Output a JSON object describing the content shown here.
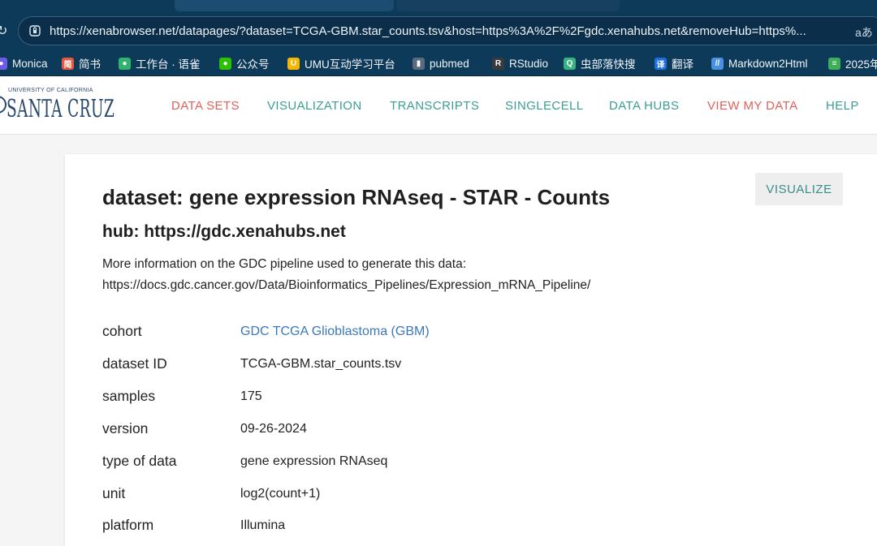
{
  "browser": {
    "url": "https://xenabrowser.net/datapages/?dataset=TCGA-GBM.star_counts.tsv&host=https%3A%2F%2Fgdc.xenahubs.net&removeHub=https%...",
    "reader_label": "aあ",
    "bookmarks": [
      {
        "label": "Monica",
        "icon": "monica-icon",
        "color": "#6c5ce7"
      },
      {
        "label": "简书",
        "icon": "jianshu-icon",
        "color": "#e9573f"
      },
      {
        "label": "工作台 · 语雀",
        "icon": "yuque-icon",
        "color": "#2fb36d"
      },
      {
        "label": "公众号",
        "icon": "wechat-icon",
        "color": "#2dc100"
      },
      {
        "label": "UMU互动学习平台",
        "icon": "umu-icon",
        "color": "#f5b700"
      },
      {
        "label": "pubmed",
        "icon": "pubmed-icon",
        "color": "#5a6b7d"
      },
      {
        "label": "RStudio",
        "icon": "rstudio-icon",
        "color": "#3a3a3a"
      },
      {
        "label": "虫部落快搜",
        "icon": "chongbuluo-icon",
        "color": "#36b37e"
      },
      {
        "label": "翻译",
        "icon": "translate-icon",
        "color": "#1e6fe0"
      },
      {
        "label": "Markdown2Html",
        "icon": "markdown-icon",
        "color": "#4a90e2"
      },
      {
        "label": "2025年",
        "icon": "doc-icon",
        "color": "#3fae5a"
      }
    ]
  },
  "logo": {
    "small": "UNIVERSITY OF CALIFORNIA",
    "big": "SANTA CRUZ"
  },
  "nav": [
    {
      "label": "DATA SETS",
      "color": "#e0605a"
    },
    {
      "label": "VISUALIZATION",
      "color": "#3a9e95"
    },
    {
      "label": "TRANSCRIPTS",
      "color": "#3a9e95"
    },
    {
      "label": "SINGLECELL",
      "color": "#3a9e95"
    },
    {
      "label": "DATA HUBS",
      "color": "#3a9e95"
    },
    {
      "label": "VIEW MY DATA",
      "color": "#e0605a"
    },
    {
      "label": "HELP",
      "color": "#3a9e95"
    }
  ],
  "dataset": {
    "title": "dataset: gene expression RNAseq - STAR - Counts",
    "hub": "hub: https://gdc.xenahubs.net",
    "info_line1": "More information on the GDC pipeline used to generate this data:",
    "info_line2": "https://docs.gdc.cancer.gov/Data/Bioinformatics_Pipelines/Expression_mRNA_Pipeline/",
    "visualize_label": "VISUALIZE",
    "meta": [
      {
        "key": "cohort",
        "value": "GDC TCGA Glioblastoma (GBM)",
        "link": true
      },
      {
        "key": "dataset ID",
        "value": "TCGA-GBM.star_counts.tsv",
        "link": false
      },
      {
        "key": "samples",
        "value": "175",
        "link": false
      },
      {
        "key": "version",
        "value": "09-26-2024",
        "link": false
      },
      {
        "key": "type of data",
        "value": "gene expression RNAseq",
        "link": false
      },
      {
        "key": "unit",
        "value": "log2(count+1)",
        "link": false
      },
      {
        "key": "platform",
        "value": "Illumina",
        "link": false
      }
    ]
  }
}
